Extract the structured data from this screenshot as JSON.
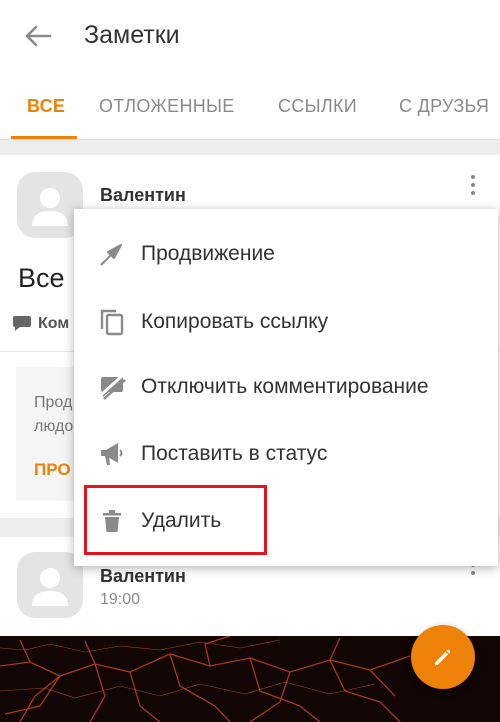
{
  "appbar": {
    "title": "Заметки",
    "back_icon": "arrow-left-icon"
  },
  "tabs": [
    {
      "label": "ВСЕ",
      "active": true
    },
    {
      "label": "ОТЛОЖЕННЫЕ",
      "active": false
    },
    {
      "label": "ССЫЛКИ",
      "active": false
    },
    {
      "label": "С ДРУЗЬЯ",
      "active": false
    }
  ],
  "note1": {
    "author": "Валентин",
    "text": "Все",
    "comments_label": "Ком",
    "promo_text": "Прод\nлюдо",
    "promo_link": "ПРО"
  },
  "note2": {
    "author": "Валентин",
    "time": "19:00"
  },
  "menu": {
    "items": [
      {
        "label": "Продвижение",
        "icon": "promote-arrow-icon"
      },
      {
        "label": "Копировать ссылку",
        "icon": "copy-icon"
      },
      {
        "label": "Отключить комментирование",
        "icon": "comments-off-icon"
      },
      {
        "label": "Поставить в статус",
        "icon": "megaphone-icon"
      },
      {
        "label": "Удалить",
        "icon": "trash-icon"
      }
    ]
  },
  "colors": {
    "accent": "#ee8208",
    "highlight": "#e3141e",
    "text": "#333333",
    "muted": "#8a8a8a"
  }
}
